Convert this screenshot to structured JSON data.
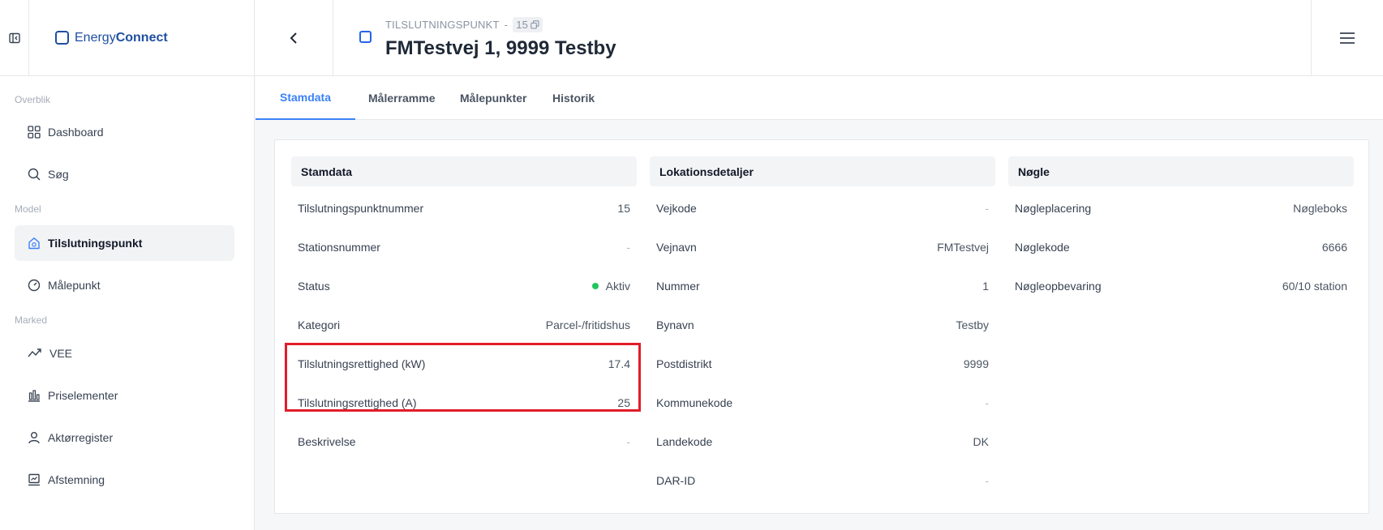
{
  "brand": {
    "name_light": "Energy",
    "name_bold": "Connect"
  },
  "header": {
    "breadcrumb_label": "TILSLUTNINGSPUNKT",
    "breadcrumb_sep": "-",
    "breadcrumb_id": "15",
    "title": "FMTestvej 1, 9999 Testby"
  },
  "sidebar": {
    "sections": [
      {
        "label": "Overblik"
      },
      {
        "label": "Model"
      },
      {
        "label": "Marked"
      }
    ],
    "items": [
      {
        "label": "Dashboard",
        "icon": "grid-icon"
      },
      {
        "label": "Søg",
        "icon": "search-icon"
      },
      {
        "label": "Tilslutningspunkt",
        "icon": "home-plug-icon",
        "active": true
      },
      {
        "label": "Målepunkt",
        "icon": "gauge-icon"
      },
      {
        "label": "VEE",
        "icon": "trend-icon"
      },
      {
        "label": "Priselementer",
        "icon": "bars-icon"
      },
      {
        "label": "Aktørregister",
        "icon": "user-icon"
      },
      {
        "label": "Afstemning",
        "icon": "chart-box-icon"
      }
    ]
  },
  "tabs": [
    {
      "label": "Stamdata",
      "active": true
    },
    {
      "label": "Målerramme"
    },
    {
      "label": "Målepunkter"
    },
    {
      "label": "Historik"
    }
  ],
  "stamdata": {
    "title": "Stamdata",
    "rows": [
      {
        "label": "Tilslutningspunktnummer",
        "value": "15"
      },
      {
        "label": "Stationsnummer",
        "value": "-"
      },
      {
        "label": "Status",
        "value": "Aktiv",
        "status_color": "#22c55e"
      },
      {
        "label": "Kategori",
        "value": "Parcel-/fritidshus"
      },
      {
        "label": "Tilslutningsrettighed (kW)",
        "value": "17.4"
      },
      {
        "label": "Tilslutningsrettighed (A)",
        "value": "25"
      },
      {
        "label": "Beskrivelse",
        "value": "-"
      }
    ]
  },
  "lokation": {
    "title": "Lokationsdetaljer",
    "rows": [
      {
        "label": "Vejkode",
        "value": "-"
      },
      {
        "label": "Vejnavn",
        "value": "FMTestvej"
      },
      {
        "label": "Nummer",
        "value": "1"
      },
      {
        "label": "Bynavn",
        "value": "Testby"
      },
      {
        "label": "Postdistrikt",
        "value": "9999"
      },
      {
        "label": "Kommunekode",
        "value": "-"
      },
      {
        "label": "Landekode",
        "value": "DK"
      },
      {
        "label": "DAR-ID",
        "value": "-"
      }
    ]
  },
  "noegle": {
    "title": "Nøgle",
    "rows": [
      {
        "label": "Nøgleplacering",
        "value": "Nøgleboks"
      },
      {
        "label": "Nøglekode",
        "value": "6666"
      },
      {
        "label": "Nøgleopbevaring",
        "value": "60/10 station"
      }
    ]
  },
  "colors": {
    "accent": "#3b82f6",
    "brand": "#1f4fa0",
    "highlight": "#e11d2a",
    "status_active": "#22c55e"
  }
}
